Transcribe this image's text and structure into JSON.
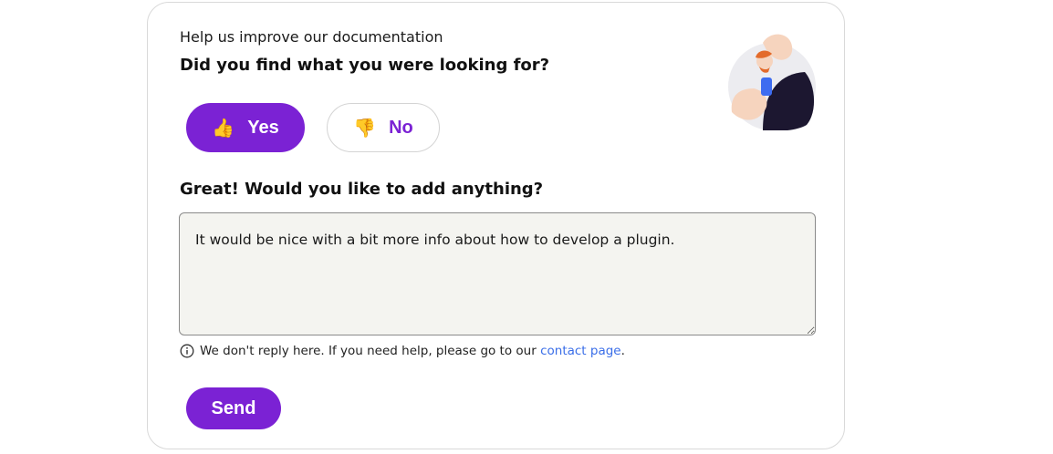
{
  "feedback": {
    "eyebrow": "Help us improve our documentation",
    "question": "Did you find what you were looking for?",
    "yes_label": "Yes",
    "no_label": "No",
    "yes_icon": "thumbs-up-icon",
    "no_icon": "thumbs-down-icon",
    "followup_question": "Great! Would you like to add anything?",
    "comment_value": "It would be nice with a bit more info about how to develop a plugin.",
    "note_text": "We don't reply here. If you need help, please go to our",
    "note_link": "contact page",
    "note_end": ".",
    "send_label": "Send",
    "selected": "yes"
  },
  "colors": {
    "accent": "#7b22d4",
    "link": "#3a6ee8",
    "textarea_bg": "#f4f4f0"
  }
}
